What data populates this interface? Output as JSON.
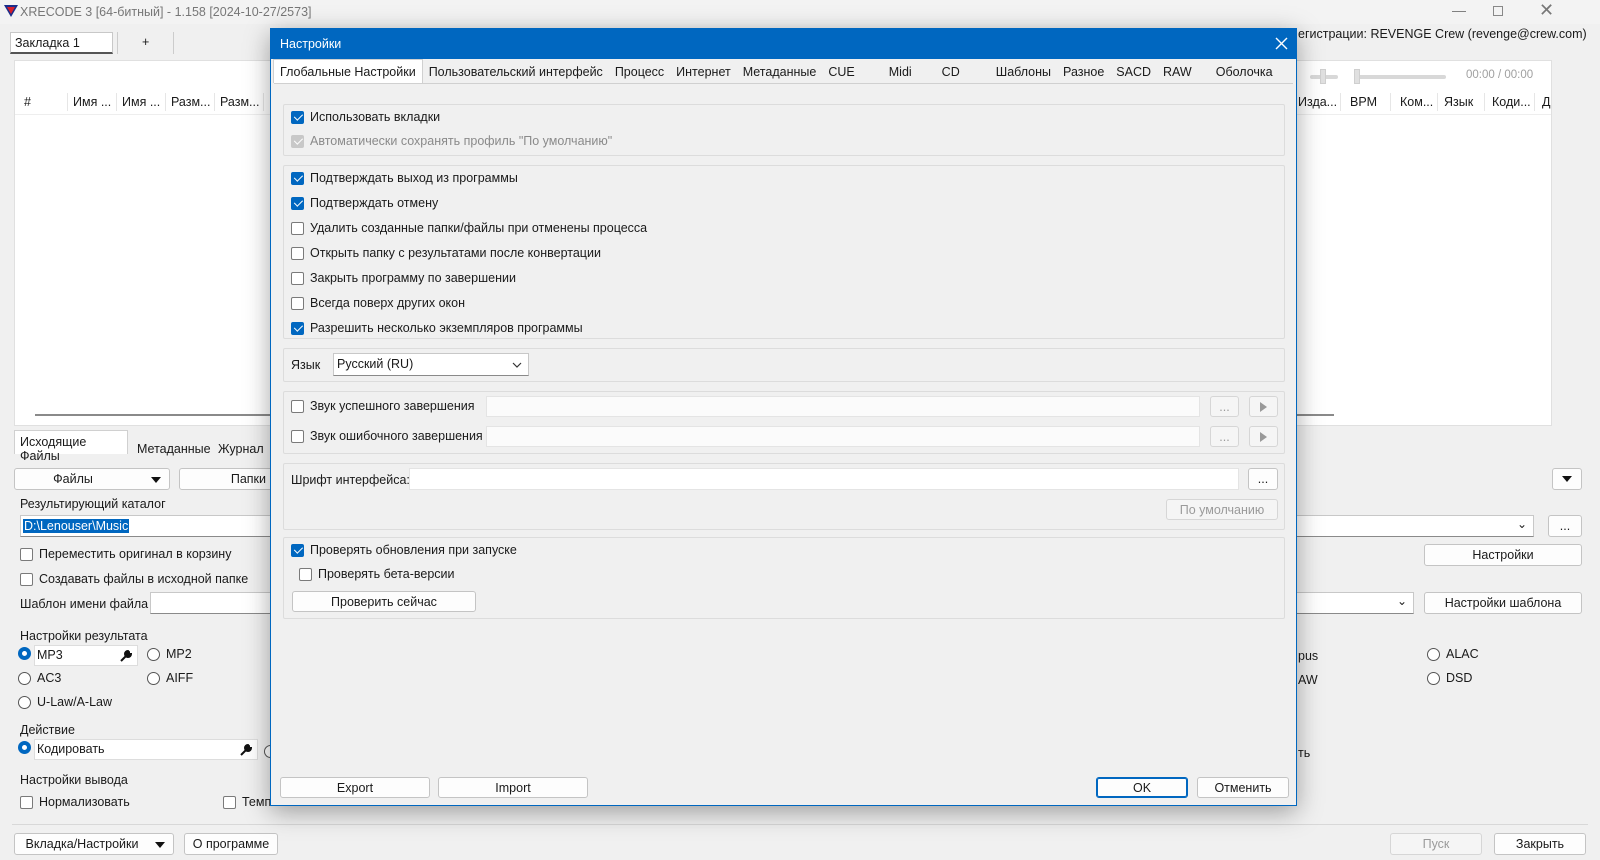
{
  "window": {
    "title": "XRECODE 3 [64-битный] - 1.158 [2024-10-27/2573]",
    "registration": "егистрации: REVENGE Crew (revenge@crew.com)"
  },
  "tabbar": {
    "tab1": "Закладка 1",
    "add": "+"
  },
  "main": {
    "columns_left": [
      "#",
      "Имя ...",
      "Имя ...",
      "Разм...",
      "Разм..."
    ],
    "columns_right": [
      "Изда...",
      "BPM",
      "Ком...",
      "Язык",
      "Коди...",
      "Д"
    ],
    "time": "00:00 / 00:00",
    "bottom_tabs": [
      "Исходящие Файлы",
      "Метаданные",
      "Журнал"
    ],
    "files_btn": "Файлы",
    "folders_btn": "Папки",
    "output_dir_label": "Результирующий каталог",
    "output_dir_value": "D:\\Lenouser\\Music",
    "move_original": "Переместить оригинал в корзину",
    "create_in_source": "Создавать файлы в исходной папке",
    "filename_template": "Шаблон имени файла",
    "settings_btn": "Настройки",
    "template_settings_btn": "Настройки шаблона",
    "result_settings": "Настройки результата",
    "formats": [
      "MP3",
      "MP2",
      "AC3",
      "AIFF",
      "U-Law/A-Law"
    ],
    "formats_right": [
      "pus",
      "ALAC",
      "AW",
      "DSD"
    ],
    "action_label": "Действие",
    "action_value": "Кодировать",
    "action_right": "ть",
    "output_settings": "Настройки вывода",
    "normalize": "Нормализовать",
    "tempo": "Темп",
    "tab_settings_btn": "Вкладка/Настройки",
    "about_btn": "О программе",
    "start_btn": "Пуск",
    "close_btn": "Закрыть",
    "ellipsis": "..."
  },
  "dialog": {
    "title": "Настройки",
    "tabs": [
      "Глобальные Настройки",
      "Пользовательский интерфейс",
      "Процесс",
      "Интернет",
      "Метаданные",
      "CUE",
      "Midi",
      "CD",
      "Шаблоны",
      "Разное",
      "SACD",
      "RAW",
      "Оболочка"
    ],
    "use_tabs": "Использовать вкладки",
    "autosave_profile": "Автоматически сохранять профиль \"По умолчанию\"",
    "confirm_exit": "Подтверждать выход из программы",
    "confirm_cancel": "Подтверждать отмену",
    "delete_created": "Удалить созданные папки/файлы при отменены процесса",
    "open_folder": "Открыть папку с результатами после конвертации",
    "close_on_finish": "Закрыть программу по завершении",
    "always_on_top": "Всегда поверх других окон",
    "multi_instance": "Разрешить несколько экземпляров программы",
    "language_label": "Язык",
    "language_value": "Русский (RU)",
    "sound_success": "Звук успешного завершения",
    "sound_error": "Звук ошибочного завершения",
    "ellipsis": "...",
    "font_label": "Шрифт интерфейса:",
    "default_btn": "По умолчанию",
    "check_updates": "Проверять обновления при запуске",
    "check_beta": "Проверять бета-версии",
    "check_now": "Проверить сейчас",
    "export": "Export",
    "import": "Import",
    "ok": "OK",
    "cancel": "Отменить"
  }
}
